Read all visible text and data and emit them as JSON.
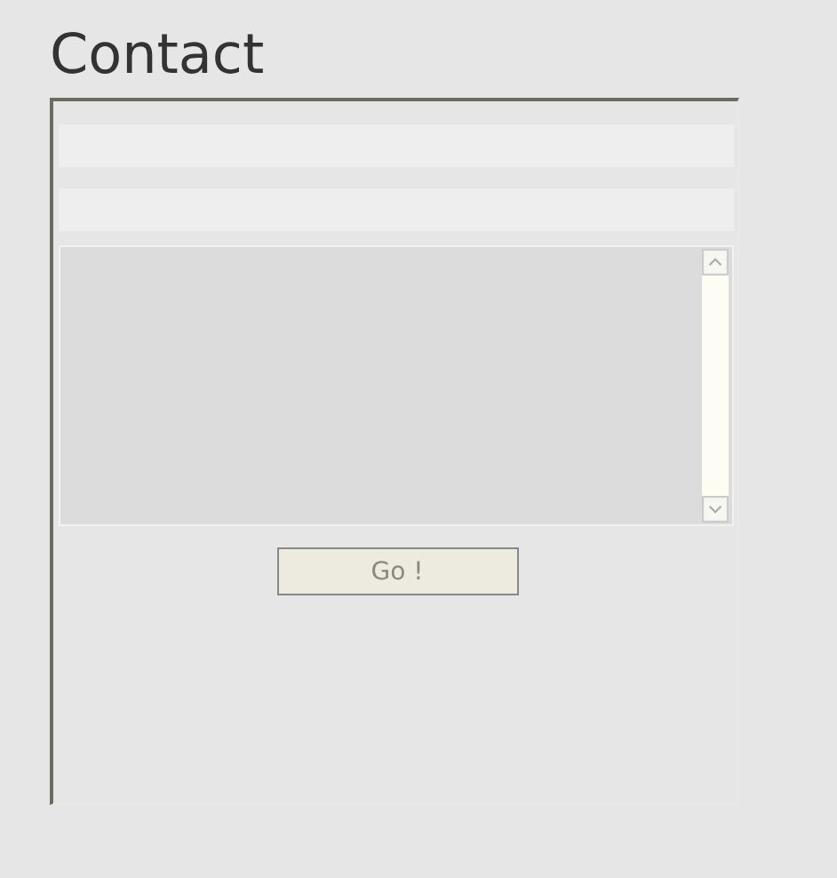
{
  "title": "Contact",
  "fields": [
    {
      "kind": "text"
    },
    {
      "kind": "text"
    },
    {
      "kind": "textarea"
    }
  ],
  "submit": {
    "label": "Go !"
  }
}
